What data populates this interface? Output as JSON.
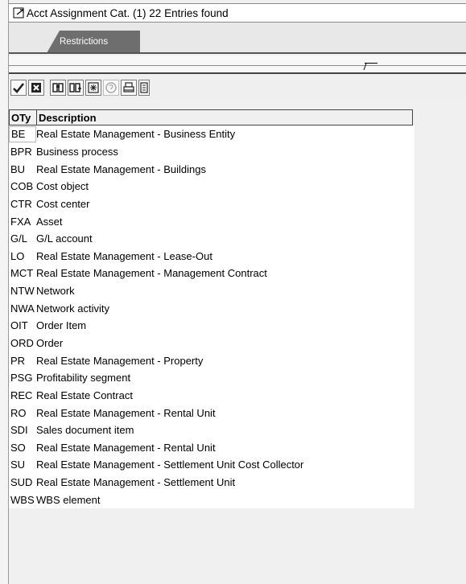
{
  "window": {
    "title": "Acct Assignment Cat. (1)   22 Entries found"
  },
  "tabs": [
    {
      "label": "Restrictions"
    }
  ],
  "table": {
    "columns": [
      "OTy",
      "Description"
    ],
    "rows": [
      {
        "code": "BE",
        "description": "Real Estate Management - Business Entity"
      },
      {
        "code": "BPR",
        "description": "Business process"
      },
      {
        "code": "BU",
        "description": "Real Estate Management - Buildings"
      },
      {
        "code": "COB",
        "description": "Cost object"
      },
      {
        "code": "CTR",
        "description": "Cost center"
      },
      {
        "code": "FXA",
        "description": "Asset"
      },
      {
        "code": "G/L",
        "description": "G/L account"
      },
      {
        "code": "LO",
        "description": "Real Estate Management - Lease-Out"
      },
      {
        "code": "MCT",
        "description": "Real Estate Management - Management Contract"
      },
      {
        "code": "NTW",
        "description": "Network"
      },
      {
        "code": "NWA",
        "description": "Network activity"
      },
      {
        "code": "OIT",
        "description": "Order Item"
      },
      {
        "code": "ORD",
        "description": "Order"
      },
      {
        "code": "PR",
        "description": "Real Estate Management - Property"
      },
      {
        "code": "PSG",
        "description": "Profitability segment"
      },
      {
        "code": "REC",
        "description": "Real Estate Contract"
      },
      {
        "code": "RO",
        "description": "Real Estate Management - Rental Unit"
      },
      {
        "code": "SDI",
        "description": "Sales document item"
      },
      {
        "code": "SO",
        "description": "Real Estate Management - Rental Unit"
      },
      {
        "code": "SU",
        "description": "Real Estate Management - Settlement Unit Cost Collector"
      },
      {
        "code": "SUD",
        "description": "Real Estate Management - Settlement Unit"
      },
      {
        "code": "WBS",
        "description": "WBS element"
      }
    ]
  },
  "toolbar": {
    "icons": [
      "check-icon",
      "cancel-icon",
      "find-icon",
      "find-next-icon",
      "multiple-selection-icon",
      "help-icon",
      "print-icon",
      "layout-icon"
    ]
  }
}
